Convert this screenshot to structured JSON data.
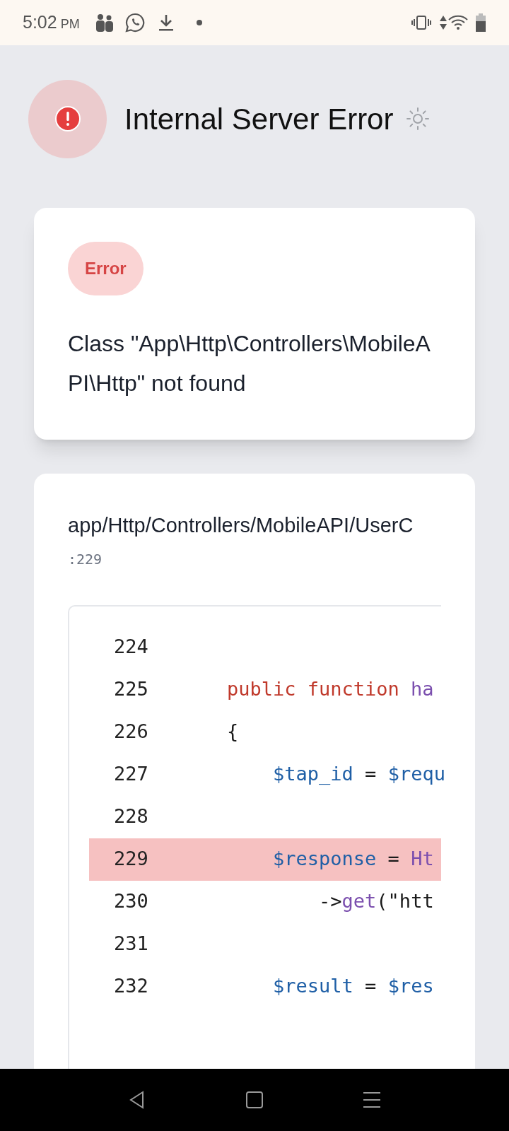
{
  "status_bar": {
    "time": "5:02",
    "ampm": "PM"
  },
  "header": {
    "title": "Internal Server Error"
  },
  "error_card": {
    "badge": "Error",
    "message": "Class \"App\\Http\\Controllers\\MobileAPI\\Http\" not found"
  },
  "source_card": {
    "path": "app/Http/Controllers/MobileAPI/UserC",
    "line_ref": ":229",
    "code_lines": [
      {
        "number": "224",
        "selected": false
      },
      {
        "number": "225",
        "selected": false,
        "tokens": [
          {
            "kind": "keyword",
            "text": "    public function "
          },
          {
            "kind": "name",
            "text": "ha"
          }
        ]
      },
      {
        "number": "226",
        "selected": false,
        "tokens": [
          {
            "kind": "plain",
            "text": "    {"
          }
        ]
      },
      {
        "number": "227",
        "selected": false,
        "tokens": [
          {
            "kind": "variable",
            "text": "        $tap_id"
          },
          {
            "kind": "plain",
            "text": " = "
          },
          {
            "kind": "variable",
            "text": "$requ"
          }
        ]
      },
      {
        "number": "228",
        "selected": false
      },
      {
        "number": "229",
        "selected": true,
        "tokens": [
          {
            "kind": "variable",
            "text": "        $response"
          },
          {
            "kind": "plain",
            "text": " = "
          },
          {
            "kind": "name",
            "text": "Ht"
          }
        ]
      },
      {
        "number": "230",
        "selected": false,
        "tokens": [
          {
            "kind": "plain",
            "text": "            ->"
          },
          {
            "kind": "name",
            "text": "get"
          },
          {
            "kind": "plain",
            "text": "(\"htt"
          }
        ]
      },
      {
        "number": "231",
        "selected": false
      },
      {
        "number": "232",
        "selected": false,
        "tokens": [
          {
            "kind": "variable",
            "text": "        $result"
          },
          {
            "kind": "plain",
            "text": " = "
          },
          {
            "kind": "variable",
            "text": "$res"
          }
        ]
      }
    ]
  }
}
